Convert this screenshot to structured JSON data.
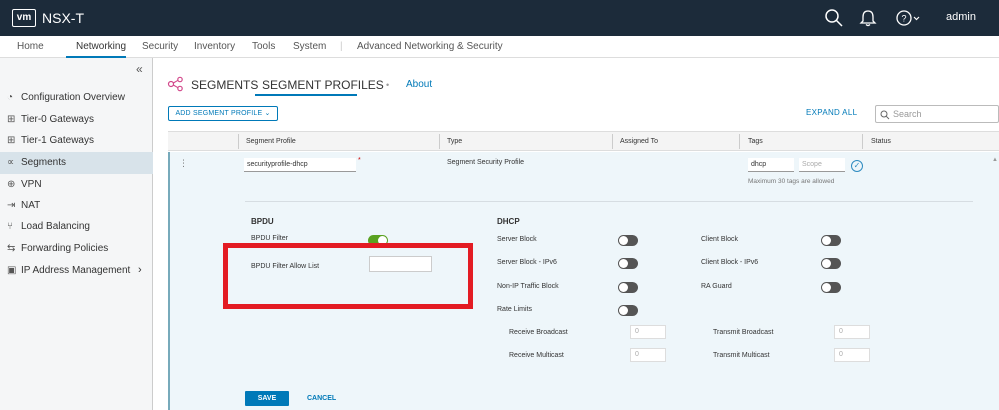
{
  "header": {
    "logo": "vm",
    "product": "NSX-T",
    "user": "admin"
  },
  "topnav": [
    "Home",
    "Networking",
    "Security",
    "Inventory",
    "Tools",
    "System",
    "Advanced Networking & Security"
  ],
  "sidebar": {
    "collapse": "«",
    "items": [
      {
        "label": "Configuration Overview",
        "icon": "dashboard-icon"
      },
      {
        "label": "Tier-0 Gateways",
        "icon": "gateway-icon"
      },
      {
        "label": "Tier-1 Gateways",
        "icon": "gateway-icon"
      },
      {
        "label": "Segments",
        "icon": "segments-icon"
      },
      {
        "label": "VPN",
        "icon": "vpn-icon"
      },
      {
        "label": "NAT",
        "icon": "nat-icon"
      },
      {
        "label": "Load Balancing",
        "icon": "load-balancing-icon"
      },
      {
        "label": "Forwarding Policies",
        "icon": "forwarding-icon"
      },
      {
        "label": "IP Address Management",
        "icon": "ipam-icon"
      }
    ]
  },
  "tabs": {
    "segments": "SEGMENTS",
    "profiles": "SEGMENT PROFILES",
    "dot": "•",
    "about": "About"
  },
  "toolbar": {
    "add": "ADD SEGMENT PROFILE ⌄",
    "expand": "EXPAND ALL",
    "search_placeholder": "Search"
  },
  "table": {
    "headers": [
      "Segment Profile",
      "Type",
      "Assigned To",
      "Tags",
      "Status"
    ],
    "row": {
      "menu": "⋮",
      "name": "securityprofile-dhcp",
      "required": "*",
      "type": "Segment Security Profile",
      "tag": "dhcp",
      "scope_placeholder": "Scope",
      "tags_hint": "Maximum 30 tags are allowed"
    }
  },
  "bpdu": {
    "title": "BPDU",
    "filter_label": "BPDU Filter",
    "filter_on": true,
    "allow_list_label": "BPDU Filter Allow List",
    "allow_list_value": ""
  },
  "dhcp": {
    "title": "DHCP",
    "server_block": "Server Block",
    "server_block_v6": "Server Block - IPv6",
    "nonip": "Non-IP Traffic Block",
    "rate_limits": "Rate Limits",
    "client_block": "Client Block",
    "client_block_v6": "Client Block - IPv6",
    "ra_guard": "RA Guard",
    "recv_bcast": "Receive Broadcast",
    "recv_mcast": "Receive Multicast",
    "tx_bcast": "Transmit Broadcast",
    "tx_mcast": "Transmit Multicast",
    "recv_bcast_val": "0",
    "recv_mcast_val": "0",
    "tx_bcast_val": "0",
    "tx_mcast_val": "0"
  },
  "actions": {
    "save": "SAVE",
    "cancel": "CANCEL"
  },
  "colors": {
    "accent": "#0079b8",
    "header": "#1c2b3a",
    "highlight": "#e31b23",
    "toggle_on": "#5aa220"
  }
}
